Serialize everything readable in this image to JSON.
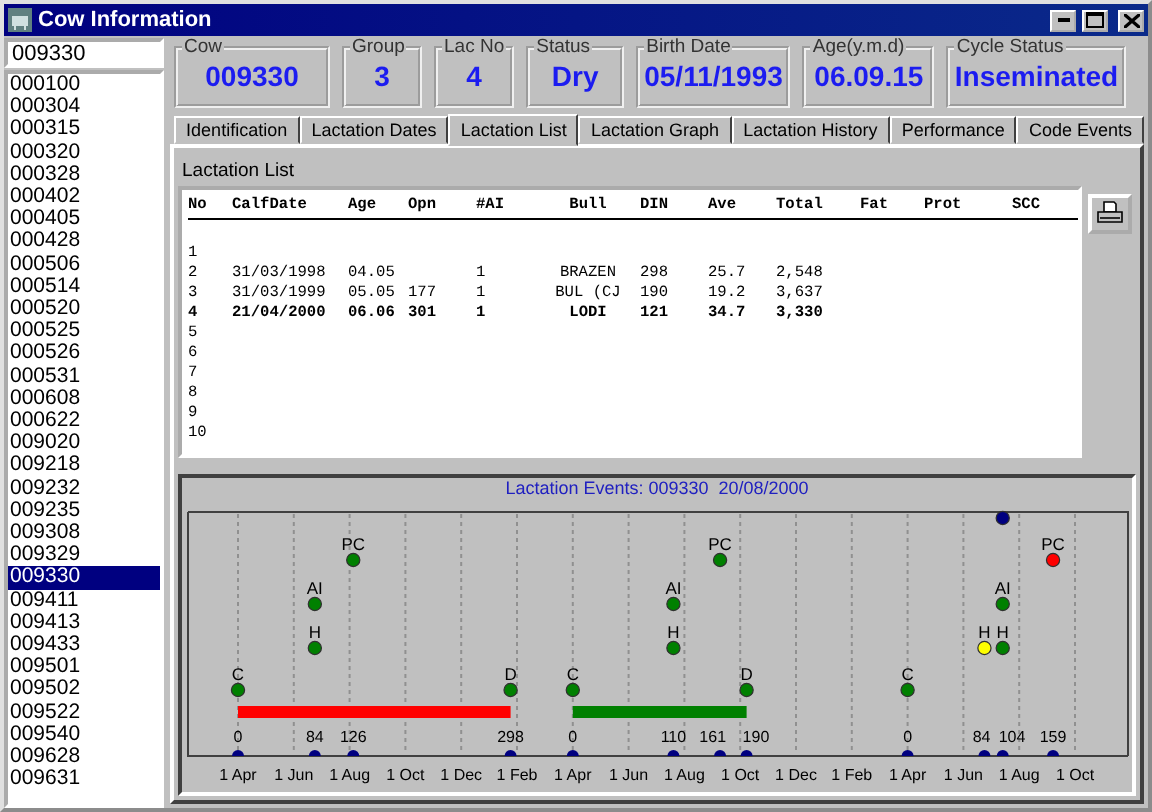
{
  "window": {
    "title": "Cow Information"
  },
  "search": {
    "value": "009330"
  },
  "cows": [
    {
      "id": "000100",
      "selected": false
    },
    {
      "id": "000304",
      "selected": false
    },
    {
      "id": "000315",
      "selected": false
    },
    {
      "id": "000320",
      "selected": false
    },
    {
      "id": "000328",
      "selected": false
    },
    {
      "id": "000402",
      "selected": false
    },
    {
      "id": "000405",
      "selected": false
    },
    {
      "id": "000428",
      "selected": false
    },
    {
      "id": "000506",
      "selected": false
    },
    {
      "id": "000514",
      "selected": false
    },
    {
      "id": "000520",
      "selected": false
    },
    {
      "id": "000525",
      "selected": false
    },
    {
      "id": "000526",
      "selected": false
    },
    {
      "id": "000531",
      "selected": false
    },
    {
      "id": "000608",
      "selected": false
    },
    {
      "id": "000622",
      "selected": false
    },
    {
      "id": "009020",
      "selected": false
    },
    {
      "id": "009218",
      "selected": false
    },
    {
      "id": "009232",
      "selected": false
    },
    {
      "id": "009235",
      "selected": false
    },
    {
      "id": "009308",
      "selected": false
    },
    {
      "id": "009329",
      "selected": false
    },
    {
      "id": "009330",
      "selected": true
    },
    {
      "id": "009411",
      "selected": false
    },
    {
      "id": "009413",
      "selected": false
    },
    {
      "id": "009433",
      "selected": false
    },
    {
      "id": "009501",
      "selected": false
    },
    {
      "id": "009502",
      "selected": false
    },
    {
      "id": "009522",
      "selected": false
    },
    {
      "id": "009540",
      "selected": false
    },
    {
      "id": "009628",
      "selected": false
    },
    {
      "id": "009631",
      "selected": false
    }
  ],
  "summary": [
    {
      "label": "Cow",
      "value": "009330"
    },
    {
      "label": "Group",
      "value": "3"
    },
    {
      "label": "Lac No",
      "value": "4"
    },
    {
      "label": "Status",
      "value": "Dry"
    },
    {
      "label": "Birth Date",
      "value": "05/11/1993"
    },
    {
      "label": "Age(y.m.d)",
      "value": "06.09.15"
    },
    {
      "label": "Cycle Status",
      "value": "Inseminated"
    }
  ],
  "tabs": [
    {
      "label": "Identification",
      "selected": false
    },
    {
      "label": "Lactation Dates",
      "selected": false
    },
    {
      "label": "Lactation List",
      "selected": true
    },
    {
      "label": "Lactation Graph",
      "selected": false
    },
    {
      "label": "Lactation History",
      "selected": false
    },
    {
      "label": "Performance",
      "selected": false
    },
    {
      "label": "Code Events",
      "selected": false
    }
  ],
  "lactation_list": {
    "title": "Lactation List",
    "columns": [
      "No",
      "CalfDate",
      "Age",
      "Opn",
      "#AI",
      "Bull",
      "DIN",
      "Ave",
      "Total",
      "Fat",
      "Prot",
      "SCC"
    ],
    "rows": [
      {
        "no": "1",
        "current": false
      },
      {
        "no": "2",
        "current": false,
        "calf_date": "31/03/1998",
        "age": "04.05",
        "ai": "1",
        "bull": "BRAZEN",
        "din": "298",
        "ave": "25.7",
        "total": "2,548"
      },
      {
        "no": "3",
        "current": false,
        "calf_date": "31/03/1999",
        "age": "05.05",
        "opn": "177",
        "ai": "1",
        "bull": "BUL (CJ",
        "din": "190",
        "ave": "19.2",
        "total": "3,637"
      },
      {
        "no": "4",
        "current": true,
        "calf_date": "21/04/2000",
        "age": "06.06",
        "opn": "301",
        "ai": "1",
        "bull": "LODI",
        "din": "121",
        "ave": "34.7",
        "total": "3,330"
      },
      {
        "no": "5",
        "current": false
      },
      {
        "no": "6",
        "current": false
      },
      {
        "no": "7",
        "current": false
      },
      {
        "no": "8",
        "current": false
      },
      {
        "no": "9",
        "current": false
      },
      {
        "no": "10",
        "current": false
      }
    ]
  },
  "events_chart": {
    "title": "Lactation Events: 009330  20/08/2000",
    "ticks": [
      "1 Apr",
      "1 Jun",
      "1 Aug",
      "1 Oct",
      "1 Dec",
      "1 Feb",
      "1 Apr",
      "1 Jun",
      "1 Aug",
      "1 Oct",
      "1 Dec",
      "1 Feb",
      "1 Apr",
      "1 Jun",
      "1 Aug",
      "1 Oct"
    ],
    "lactations": [
      {
        "color": "#ff0000",
        "days": [
          {
            "label": "0",
            "events": [
              {
                "code": "C",
                "kind": "calving",
                "color": "#008000"
              }
            ]
          },
          {
            "label": "84",
            "events": [
              {
                "code": "AI",
                "kind": "insemination",
                "color": "#008000"
              },
              {
                "code": "H",
                "kind": "heat",
                "color": "#008000"
              }
            ]
          },
          {
            "label": "126",
            "events": [
              {
                "code": "PC",
                "kind": "pregnancy_check",
                "color": "#008000"
              }
            ]
          },
          {
            "label": "298",
            "events": [
              {
                "code": "D",
                "kind": "dry_off",
                "color": "#008000"
              }
            ]
          }
        ]
      },
      {
        "color": "#008000",
        "days": [
          {
            "label": "0",
            "events": [
              {
                "code": "C",
                "kind": "calving",
                "color": "#008000"
              }
            ]
          },
          {
            "label": "110",
            "events": [
              {
                "code": "AI",
                "kind": "insemination",
                "color": "#008000"
              },
              {
                "code": "H",
                "kind": "heat",
                "color": "#008000"
              }
            ]
          },
          {
            "label": "161",
            "events": [
              {
                "code": "PC",
                "kind": "pregnancy_check",
                "color": "#008000"
              }
            ]
          },
          {
            "label": "190",
            "events": [
              {
                "code": "D",
                "kind": "dry_off",
                "color": "#008000"
              }
            ]
          }
        ]
      },
      {
        "days": [
          {
            "label": "0",
            "events": [
              {
                "code": "C",
                "kind": "calving",
                "color": "#008000"
              }
            ]
          },
          {
            "label": "84",
            "events": [
              {
                "code": "H",
                "kind": "heat",
                "color": "#ffff00"
              }
            ]
          },
          {
            "label": "104",
            "events": [
              {
                "kind": "other",
                "color": "#000080"
              },
              {
                "code": "AI",
                "kind": "insemination",
                "color": "#008000"
              },
              {
                "code": "H",
                "kind": "heat",
                "color": "#008000"
              }
            ]
          },
          {
            "label": "159",
            "events": [
              {
                "code": "PC",
                "kind": "pregnancy_check",
                "color": "#ff0000"
              }
            ]
          }
        ]
      }
    ]
  }
}
